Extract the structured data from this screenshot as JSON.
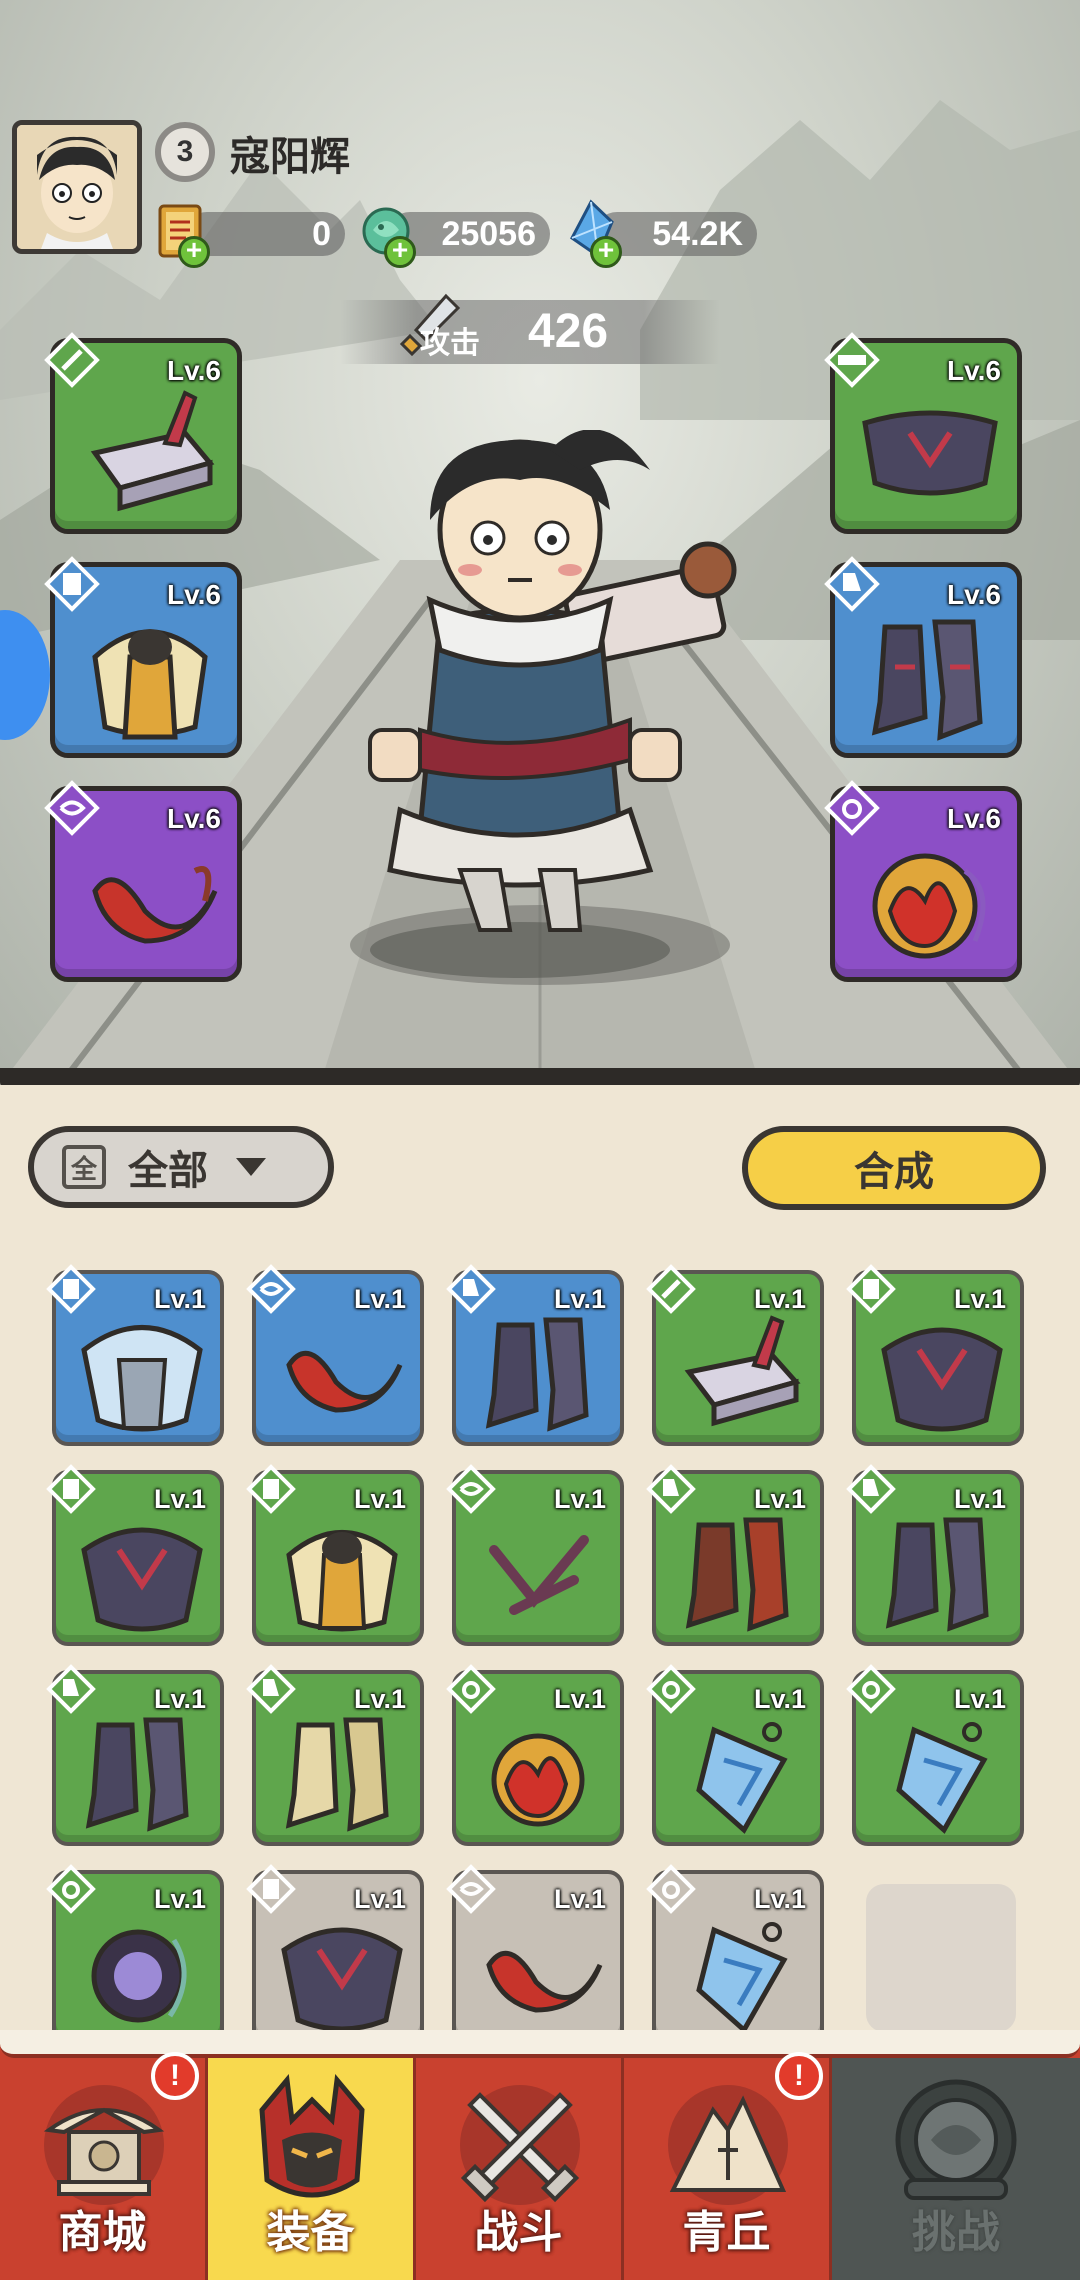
{
  "player": {
    "level": "3",
    "name": "寇阳辉"
  },
  "currencies": [
    {
      "name": "token",
      "icon": "scroll-token-icon",
      "value": "0"
    },
    {
      "name": "jade",
      "icon": "jade-dragon-icon",
      "value": "25056"
    },
    {
      "name": "crystal",
      "icon": "blue-crystal-icon",
      "value": "54.2K"
    }
  ],
  "stats": {
    "attack_label": "攻击",
    "attack_value": "426"
  },
  "equipped": [
    {
      "slot": "weapon",
      "level": "Lv.6",
      "rarity": "green",
      "icon": "anvil-blade-icon"
    },
    {
      "slot": "armor",
      "level": "Lv.6",
      "rarity": "blue",
      "icon": "golden-armor-icon"
    },
    {
      "slot": "accessory",
      "level": "Lv.6",
      "rarity": "purple",
      "icon": "red-sash-icon"
    },
    {
      "slot": "belt",
      "level": "Lv.6",
      "rarity": "green",
      "icon": "dark-belt-icon"
    },
    {
      "slot": "boots",
      "level": "Lv.6",
      "rarity": "blue",
      "icon": "dark-boots-icon"
    },
    {
      "slot": "amulet",
      "level": "Lv.6",
      "rarity": "purple",
      "icon": "flame-orb-icon"
    }
  ],
  "filter": {
    "badge": "全",
    "label": "全部"
  },
  "synthesize_label": "合成",
  "inventory": [
    {
      "level": "Lv.1",
      "rarity": "blue",
      "icon": "ice-armor-icon"
    },
    {
      "level": "Lv.1",
      "rarity": "blue",
      "icon": "red-sash-icon"
    },
    {
      "level": "Lv.1",
      "rarity": "blue",
      "icon": "dark-boots-icon"
    },
    {
      "level": "Lv.1",
      "rarity": "green",
      "icon": "anvil-blade-icon"
    },
    {
      "level": "Lv.1",
      "rarity": "green",
      "icon": "dark-armor-icon"
    },
    {
      "level": "Lv.1",
      "rarity": "green",
      "icon": "dark-armor-icon"
    },
    {
      "level": "Lv.1",
      "rarity": "green",
      "icon": "golden-armor-icon"
    },
    {
      "level": "Lv.1",
      "rarity": "green",
      "icon": "thorn-sash-icon"
    },
    {
      "level": "Lv.1",
      "rarity": "green",
      "icon": "red-boots-icon"
    },
    {
      "level": "Lv.1",
      "rarity": "green",
      "icon": "dark-boots-icon"
    },
    {
      "level": "Lv.1",
      "rarity": "green",
      "icon": "dark-boots-icon"
    },
    {
      "level": "Lv.1",
      "rarity": "green",
      "icon": "bone-boots-icon"
    },
    {
      "level": "Lv.1",
      "rarity": "green",
      "icon": "flame-orb-icon"
    },
    {
      "level": "Lv.1",
      "rarity": "green",
      "icon": "jade-pendant-icon"
    },
    {
      "level": "Lv.1",
      "rarity": "green",
      "icon": "jade-pendant-icon"
    },
    {
      "level": "Lv.1",
      "rarity": "green",
      "icon": "dark-orb-icon"
    },
    {
      "level": "Lv.1",
      "rarity": "grey",
      "icon": "dark-armor-icon"
    },
    {
      "level": "Lv.1",
      "rarity": "grey",
      "icon": "red-sash-icon"
    },
    {
      "level": "Lv.1",
      "rarity": "grey",
      "icon": "jade-pendant-icon"
    }
  ],
  "nav": [
    {
      "label": "商城",
      "icon": "shop-pavilion-icon",
      "alert": "!",
      "state": "normal"
    },
    {
      "label": "装备",
      "icon": "demon-helmet-icon",
      "alert": "",
      "state": "active"
    },
    {
      "label": "战斗",
      "icon": "crossed-swords-icon",
      "alert": "",
      "state": "normal"
    },
    {
      "label": "青丘",
      "icon": "mountain-icon",
      "alert": "!",
      "state": "normal"
    },
    {
      "label": "挑战",
      "icon": "locked-portal-icon",
      "alert": "",
      "state": "disabled"
    }
  ],
  "colors": {
    "green": "#5fa64c",
    "blue": "#4f8fce",
    "purple": "#8c4fc6",
    "grey": "#c7c0b6",
    "nav_red": "#c9412f",
    "nav_active": "#f8d94e",
    "synth_yellow": "#f6cf47"
  }
}
